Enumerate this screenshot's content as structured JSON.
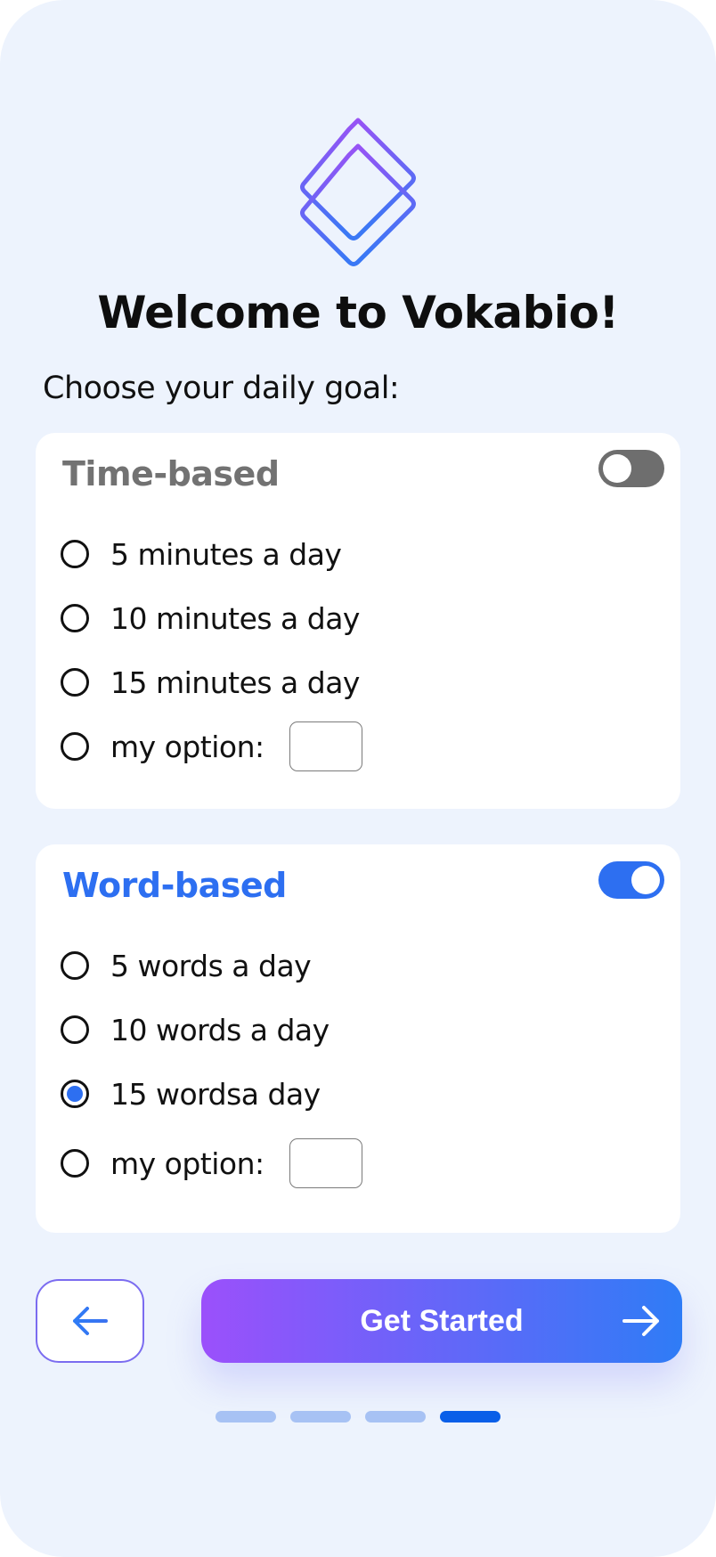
{
  "title": "Welcome to Vokabio!",
  "subtitle": "Choose your daily goal:",
  "colors": {
    "accent_blue": "#2d6ff1",
    "accent_purple": "#9b50fb",
    "background": "#edf3fd",
    "inactive_gray": "#727272"
  },
  "time_based": {
    "title": "Time-based",
    "enabled": false,
    "options": [
      {
        "label": "5 minutes a day",
        "selected": false
      },
      {
        "label": "10 minutes a day",
        "selected": false
      },
      {
        "label": "15 minutes a day",
        "selected": false
      },
      {
        "label": "my option:",
        "selected": false,
        "value": ""
      }
    ]
  },
  "word_based": {
    "title": "Word-based",
    "enabled": true,
    "options": [
      {
        "label": "5 words a day",
        "selected": false
      },
      {
        "label": "10 words a day",
        "selected": false
      },
      {
        "label": "15 wordsa day",
        "selected": true
      },
      {
        "label": "my option:",
        "selected": false,
        "value": ""
      }
    ]
  },
  "navigation": {
    "back_icon": "arrow-left-icon",
    "primary_label": "Get Started",
    "primary_icon": "arrow-right-icon"
  },
  "pagination": {
    "total": 4,
    "current": 4
  }
}
